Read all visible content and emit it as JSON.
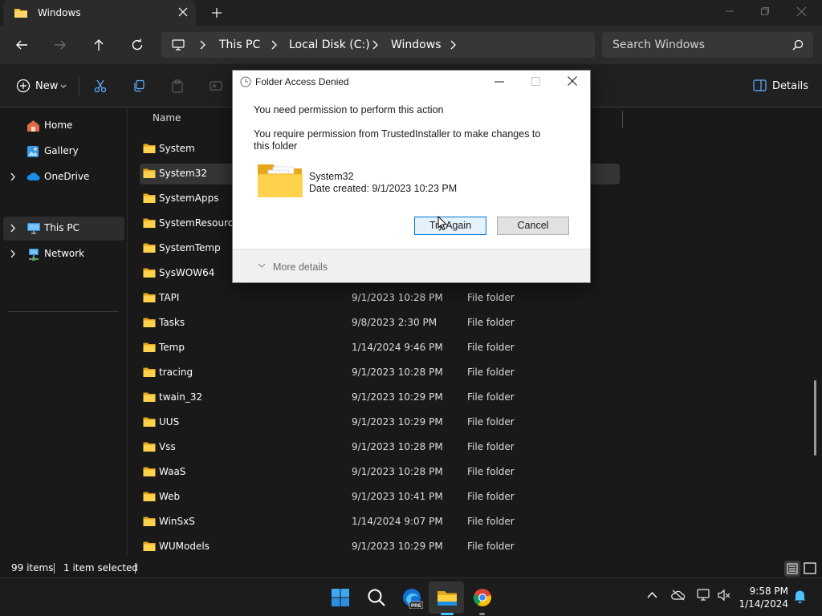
{
  "window": {
    "tab_title": "Windows",
    "colors": {
      "folder": "#f5c242",
      "accent": "#4cc2ff"
    }
  },
  "address": {
    "crumbs": [
      "This PC",
      "Local Disk (C:)",
      "Windows"
    ],
    "search_placeholder": "Search Windows"
  },
  "toolbar": {
    "new_label": "New",
    "details_label": "Details",
    "icons": [
      "cut-icon",
      "copy-icon",
      "paste-icon",
      "rename-icon"
    ]
  },
  "sidebar": {
    "items": [
      {
        "label": "Home",
        "icon": "home-icon",
        "expandable": false
      },
      {
        "label": "Gallery",
        "icon": "gallery-icon",
        "expandable": false
      },
      {
        "label": "OneDrive",
        "icon": "cloud-icon",
        "expandable": true
      },
      {
        "label": "This PC",
        "icon": "this-pc-icon",
        "expandable": true,
        "selected": true
      },
      {
        "label": "Network",
        "icon": "network-icon",
        "expandable": true
      }
    ]
  },
  "file_list": {
    "column_name": "Name",
    "rows": [
      {
        "name": "System",
        "date": "",
        "type": ""
      },
      {
        "name": "System32",
        "date": "",
        "type": "",
        "selected": true
      },
      {
        "name": "SystemApps",
        "date": "",
        "type": ""
      },
      {
        "name": "SystemResources",
        "date": "",
        "type": ""
      },
      {
        "name": "SystemTemp",
        "date": "",
        "type": ""
      },
      {
        "name": "SysWOW64",
        "date": "",
        "type": ""
      },
      {
        "name": "TAPI",
        "date": "9/1/2023 10:28 PM",
        "type": "File folder"
      },
      {
        "name": "Tasks",
        "date": "9/8/2023 2:30 PM",
        "type": "File folder"
      },
      {
        "name": "Temp",
        "date": "1/14/2024 9:46 PM",
        "type": "File folder"
      },
      {
        "name": "tracing",
        "date": "9/1/2023 10:28 PM",
        "type": "File folder"
      },
      {
        "name": "twain_32",
        "date": "9/1/2023 10:29 PM",
        "type": "File folder"
      },
      {
        "name": "UUS",
        "date": "9/1/2023 10:29 PM",
        "type": "File folder"
      },
      {
        "name": "Vss",
        "date": "9/1/2023 10:28 PM",
        "type": "File folder"
      },
      {
        "name": "WaaS",
        "date": "9/1/2023 10:28 PM",
        "type": "File folder"
      },
      {
        "name": "Web",
        "date": "9/1/2023 10:41 PM",
        "type": "File folder"
      },
      {
        "name": "WinSxS",
        "date": "1/14/2024 9:07 PM",
        "type": "File folder"
      },
      {
        "name": "WUModels",
        "date": "9/1/2023 10:29 PM",
        "type": "File folder"
      }
    ]
  },
  "status": {
    "item_count": "99 items",
    "selection": "1 item selected"
  },
  "dialog": {
    "title": "Folder Access Denied",
    "message": "You need permission to perform this action",
    "detail": "You require permission from TrustedInstaller to make changes to this folder",
    "folder_name": "System32",
    "date_created": "Date created: 9/1/2023 10:23 PM",
    "try_again_label": "Try Again",
    "cancel_label": "Cancel",
    "more_details_label": "More details"
  },
  "taskbar": {
    "apps": [
      "windows-start-icon",
      "search-icon",
      "edge-beta-icon",
      "file-explorer-icon",
      "chrome-icon"
    ],
    "edge_badge": "PRE",
    "time": "9:58 PM",
    "date": "1/14/2024"
  }
}
